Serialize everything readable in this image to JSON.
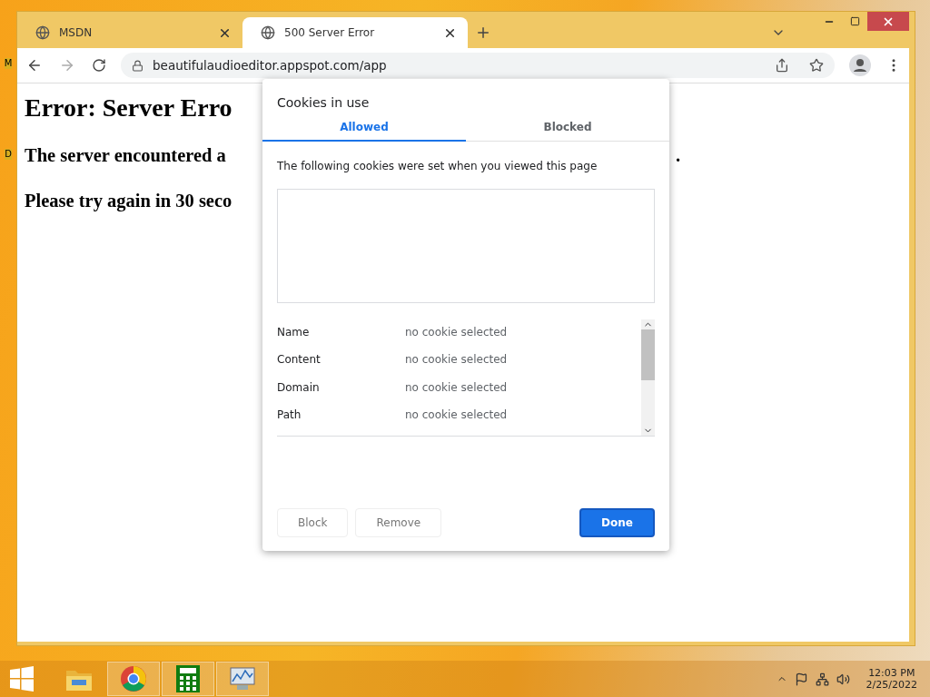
{
  "desktop_labels": [
    "M",
    "D"
  ],
  "tabs": [
    {
      "title": "MSDN",
      "selected": false
    },
    {
      "title": "500 Server Error",
      "selected": true
    }
  ],
  "address": {
    "url": "beautifulaudioeditor.appspot.com/app"
  },
  "page": {
    "heading": "Error: Server Erro",
    "lines": [
      "The server encountered a",
      "Please try again in 30 seco"
    ],
    "tail": "."
  },
  "dialog": {
    "title": "Cookies in use",
    "tabs": [
      {
        "label": "Allowed",
        "selected": true
      },
      {
        "label": "Blocked",
        "selected": false
      }
    ],
    "description": "The following cookies were set when you viewed this page",
    "fields": [
      {
        "label": "Name",
        "value": "no cookie selected"
      },
      {
        "label": "Content",
        "value": "no cookie selected"
      },
      {
        "label": "Domain",
        "value": "no cookie selected"
      },
      {
        "label": "Path",
        "value": "no cookie selected"
      }
    ],
    "buttons": [
      {
        "label": "Block",
        "kind": "secondary"
      },
      {
        "label": "Remove",
        "kind": "secondary"
      },
      {
        "label": "Done",
        "kind": "primary"
      }
    ]
  },
  "taskbar": {
    "apps": [
      {
        "kind": "folder",
        "running": false
      },
      {
        "kind": "chrome",
        "running": true
      },
      {
        "kind": "calculator",
        "running": true
      },
      {
        "kind": "monitor",
        "running": true
      }
    ],
    "time": "12:03 PM",
    "date": "2/25/2022"
  }
}
